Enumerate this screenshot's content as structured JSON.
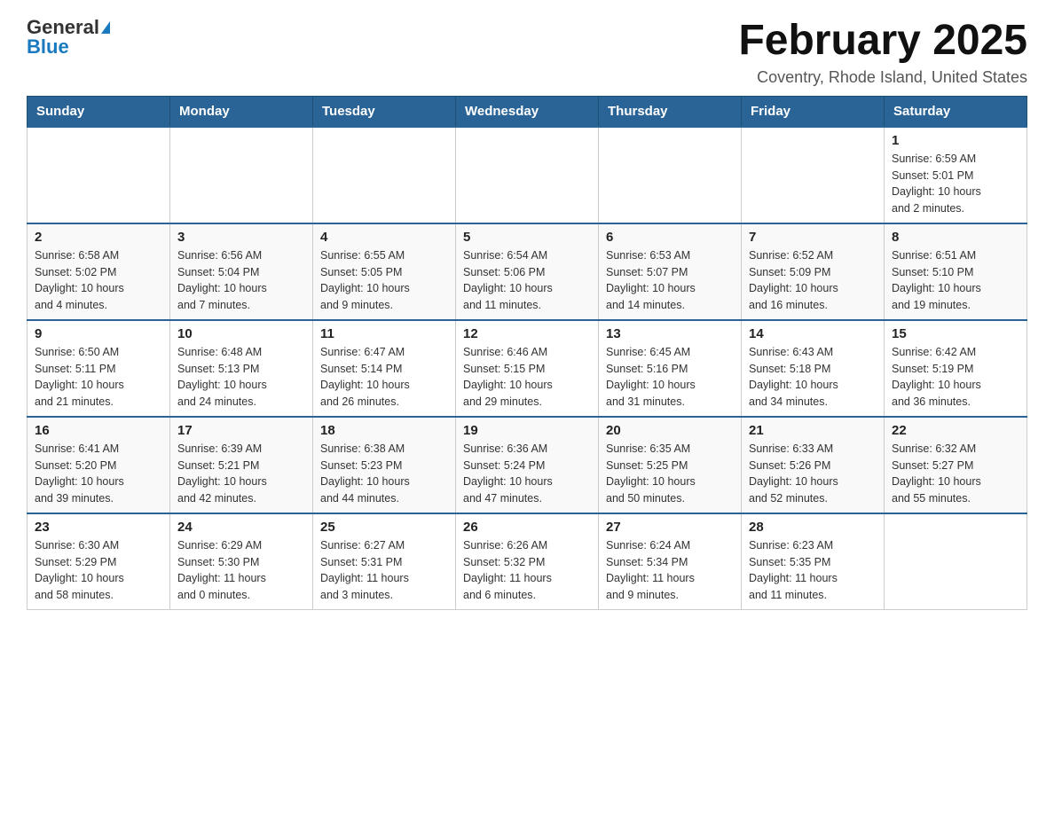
{
  "header": {
    "logo_general": "General",
    "logo_blue": "Blue",
    "month_title": "February 2025",
    "location": "Coventry, Rhode Island, United States"
  },
  "weekdays": [
    "Sunday",
    "Monday",
    "Tuesday",
    "Wednesday",
    "Thursday",
    "Friday",
    "Saturday"
  ],
  "weeks": [
    [
      {
        "day": "",
        "info": ""
      },
      {
        "day": "",
        "info": ""
      },
      {
        "day": "",
        "info": ""
      },
      {
        "day": "",
        "info": ""
      },
      {
        "day": "",
        "info": ""
      },
      {
        "day": "",
        "info": ""
      },
      {
        "day": "1",
        "info": "Sunrise: 6:59 AM\nSunset: 5:01 PM\nDaylight: 10 hours\nand 2 minutes."
      }
    ],
    [
      {
        "day": "2",
        "info": "Sunrise: 6:58 AM\nSunset: 5:02 PM\nDaylight: 10 hours\nand 4 minutes."
      },
      {
        "day": "3",
        "info": "Sunrise: 6:56 AM\nSunset: 5:04 PM\nDaylight: 10 hours\nand 7 minutes."
      },
      {
        "day": "4",
        "info": "Sunrise: 6:55 AM\nSunset: 5:05 PM\nDaylight: 10 hours\nand 9 minutes."
      },
      {
        "day": "5",
        "info": "Sunrise: 6:54 AM\nSunset: 5:06 PM\nDaylight: 10 hours\nand 11 minutes."
      },
      {
        "day": "6",
        "info": "Sunrise: 6:53 AM\nSunset: 5:07 PM\nDaylight: 10 hours\nand 14 minutes."
      },
      {
        "day": "7",
        "info": "Sunrise: 6:52 AM\nSunset: 5:09 PM\nDaylight: 10 hours\nand 16 minutes."
      },
      {
        "day": "8",
        "info": "Sunrise: 6:51 AM\nSunset: 5:10 PM\nDaylight: 10 hours\nand 19 minutes."
      }
    ],
    [
      {
        "day": "9",
        "info": "Sunrise: 6:50 AM\nSunset: 5:11 PM\nDaylight: 10 hours\nand 21 minutes."
      },
      {
        "day": "10",
        "info": "Sunrise: 6:48 AM\nSunset: 5:13 PM\nDaylight: 10 hours\nand 24 minutes."
      },
      {
        "day": "11",
        "info": "Sunrise: 6:47 AM\nSunset: 5:14 PM\nDaylight: 10 hours\nand 26 minutes."
      },
      {
        "day": "12",
        "info": "Sunrise: 6:46 AM\nSunset: 5:15 PM\nDaylight: 10 hours\nand 29 minutes."
      },
      {
        "day": "13",
        "info": "Sunrise: 6:45 AM\nSunset: 5:16 PM\nDaylight: 10 hours\nand 31 minutes."
      },
      {
        "day": "14",
        "info": "Sunrise: 6:43 AM\nSunset: 5:18 PM\nDaylight: 10 hours\nand 34 minutes."
      },
      {
        "day": "15",
        "info": "Sunrise: 6:42 AM\nSunset: 5:19 PM\nDaylight: 10 hours\nand 36 minutes."
      }
    ],
    [
      {
        "day": "16",
        "info": "Sunrise: 6:41 AM\nSunset: 5:20 PM\nDaylight: 10 hours\nand 39 minutes."
      },
      {
        "day": "17",
        "info": "Sunrise: 6:39 AM\nSunset: 5:21 PM\nDaylight: 10 hours\nand 42 minutes."
      },
      {
        "day": "18",
        "info": "Sunrise: 6:38 AM\nSunset: 5:23 PM\nDaylight: 10 hours\nand 44 minutes."
      },
      {
        "day": "19",
        "info": "Sunrise: 6:36 AM\nSunset: 5:24 PM\nDaylight: 10 hours\nand 47 minutes."
      },
      {
        "day": "20",
        "info": "Sunrise: 6:35 AM\nSunset: 5:25 PM\nDaylight: 10 hours\nand 50 minutes."
      },
      {
        "day": "21",
        "info": "Sunrise: 6:33 AM\nSunset: 5:26 PM\nDaylight: 10 hours\nand 52 minutes."
      },
      {
        "day": "22",
        "info": "Sunrise: 6:32 AM\nSunset: 5:27 PM\nDaylight: 10 hours\nand 55 minutes."
      }
    ],
    [
      {
        "day": "23",
        "info": "Sunrise: 6:30 AM\nSunset: 5:29 PM\nDaylight: 10 hours\nand 58 minutes."
      },
      {
        "day": "24",
        "info": "Sunrise: 6:29 AM\nSunset: 5:30 PM\nDaylight: 11 hours\nand 0 minutes."
      },
      {
        "day": "25",
        "info": "Sunrise: 6:27 AM\nSunset: 5:31 PM\nDaylight: 11 hours\nand 3 minutes."
      },
      {
        "day": "26",
        "info": "Sunrise: 6:26 AM\nSunset: 5:32 PM\nDaylight: 11 hours\nand 6 minutes."
      },
      {
        "day": "27",
        "info": "Sunrise: 6:24 AM\nSunset: 5:34 PM\nDaylight: 11 hours\nand 9 minutes."
      },
      {
        "day": "28",
        "info": "Sunrise: 6:23 AM\nSunset: 5:35 PM\nDaylight: 11 hours\nand 11 minutes."
      },
      {
        "day": "",
        "info": ""
      }
    ]
  ]
}
